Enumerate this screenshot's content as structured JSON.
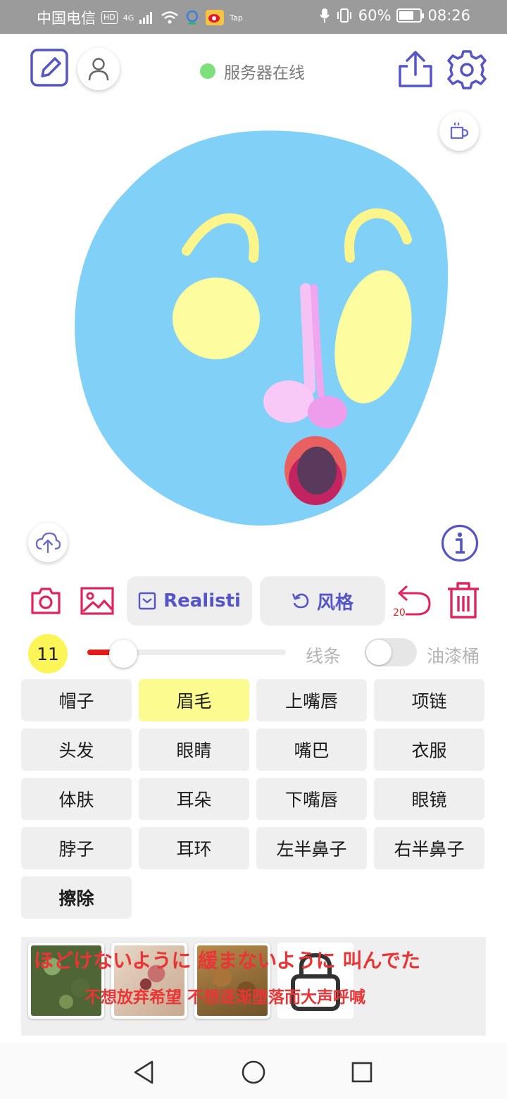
{
  "status_bar": {
    "carrier": "中国电信",
    "hd": "HD",
    "net": "4G",
    "app_tag": "Tap",
    "battery": "60%",
    "time": "08:26"
  },
  "header": {
    "server_status": "服务器在线",
    "server_status_color": "#7de07d"
  },
  "toolbar": {
    "model_label": "Realisti",
    "style_label": "风格",
    "undo_count": "20",
    "accent_color": "#5555c8",
    "icon_color": "#e0245e"
  },
  "brush": {
    "size": "11",
    "slider_level": 0.18,
    "mode_line": "线条",
    "mode_bucket": "油漆桶",
    "bucket_enabled": false
  },
  "parts": [
    {
      "label": "帽子",
      "active": false
    },
    {
      "label": "眉毛",
      "active": true
    },
    {
      "label": "上嘴唇",
      "active": false
    },
    {
      "label": "项链",
      "active": false
    },
    {
      "label": "头发",
      "active": false
    },
    {
      "label": "眼睛",
      "active": false
    },
    {
      "label": "嘴巴",
      "active": false
    },
    {
      "label": "衣服",
      "active": false
    },
    {
      "label": "体肤",
      "active": false
    },
    {
      "label": "耳朵",
      "active": false
    },
    {
      "label": "下嘴唇",
      "active": false
    },
    {
      "label": "眼镜",
      "active": false
    },
    {
      "label": "脖子",
      "active": false
    },
    {
      "label": "耳环",
      "active": false
    },
    {
      "label": "左半鼻子",
      "active": false
    },
    {
      "label": "右半鼻子",
      "active": false
    },
    {
      "label": "擦除",
      "active": false
    }
  ],
  "gallery": {
    "lyric_line1": "ほどけないように 緩まないように 叫んでた",
    "lyric_line2": "不想放弃希望 不想逐渐堕落而大声呼喊"
  },
  "icons": {
    "edit": "edit-square-icon",
    "user": "user-icon",
    "share": "share-icon",
    "settings": "gear-icon",
    "coffee": "coffee-icon",
    "upload": "cloud-upload-icon",
    "info": "info-icon",
    "camera": "camera-icon",
    "image": "image-icon",
    "model": "checkbox-icon",
    "style": "refresh-icon",
    "undo": "undo-icon",
    "delete": "trash-icon",
    "lock": "lock-icon"
  }
}
